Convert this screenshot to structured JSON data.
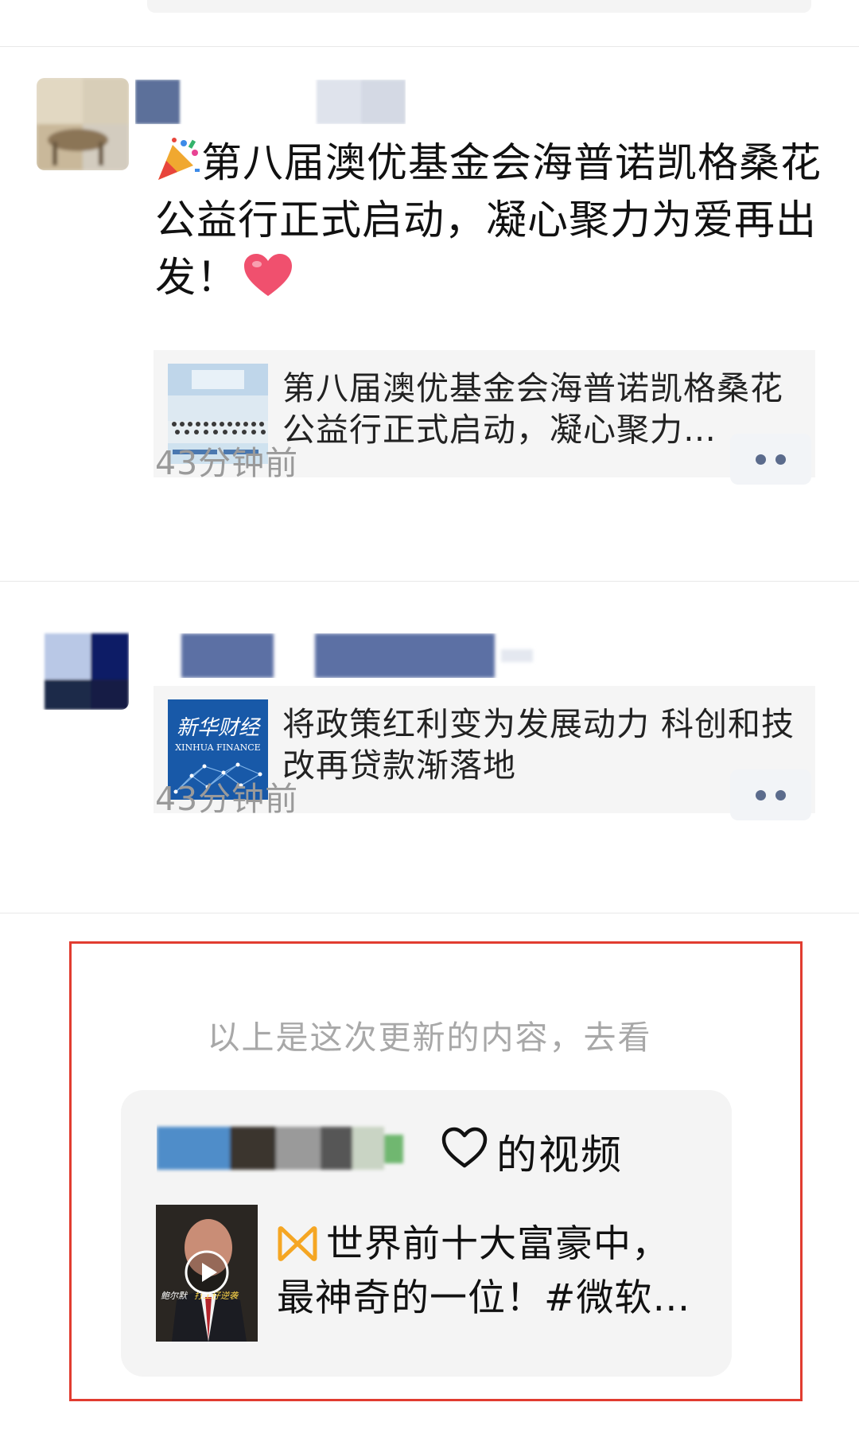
{
  "posts": [
    {
      "text": "第八届澳优基金会海普诺凯格桑花公益行正式启动，凝心聚力为爱再出发！",
      "emoji_before": "party-popper",
      "emoji_after": "red-heart",
      "link_title": "第八届澳优基金会海普诺凯格桑花公益行正式启动，凝心聚力…",
      "time": "43分钟前"
    },
    {
      "link_title": "将政策红利变为发展动力 科创和技改再贷款渐落地",
      "link_logo_cn": "新华财经",
      "link_logo_en": "XINHUA FINANCE",
      "time": "43分钟前"
    }
  ],
  "update_notice": {
    "hint": "以上是这次更新的内容，去看",
    "suffix": "的视频",
    "video_title": "世界前十大富豪中，最神奇的一位！#微软…",
    "video_thumb_caption": "鲍尔默",
    "video_thumb_caption2": "打工仔逆袭"
  },
  "colors": {
    "accent_frame": "#e13c30",
    "time_gray": "#9a9a9a",
    "hint_gray": "#a8a8a8",
    "card_bg": "#f5f5f5",
    "channels_orange": "#f5a623"
  },
  "icons": [
    "party-popper-icon",
    "heart-emoji-icon",
    "more-dots-icon",
    "heart-outline-icon",
    "channels-icon",
    "play-icon"
  ]
}
